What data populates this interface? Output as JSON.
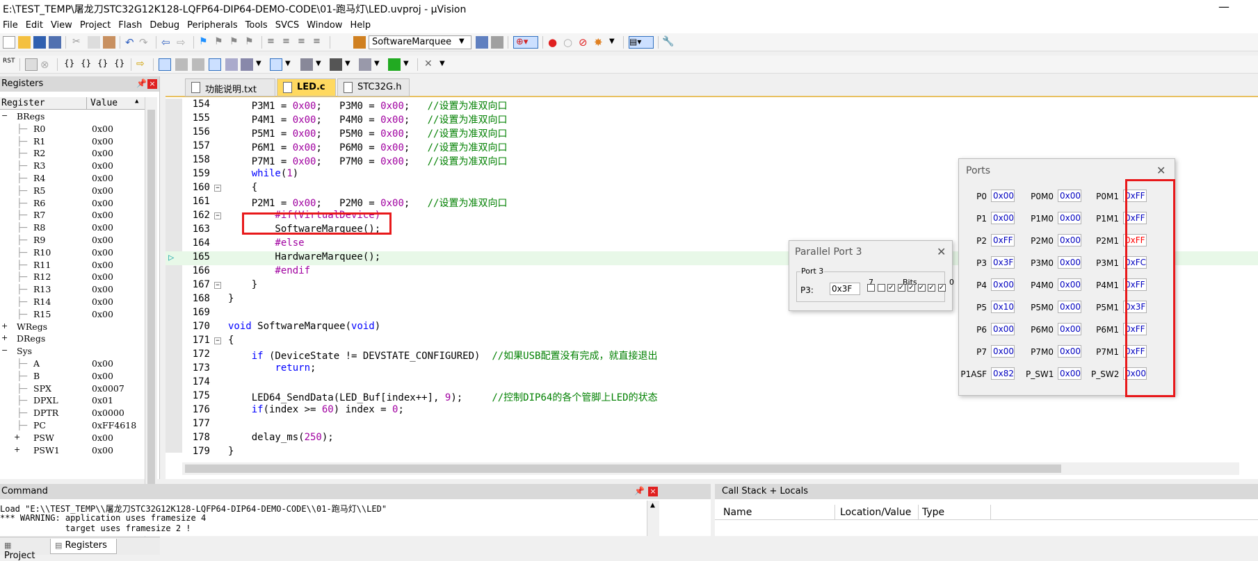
{
  "window": {
    "title": "E:\\TEST_TEMP\\屠龙刀STC32G12K128-LQFP64-DIP64-DEMO-CODE\\01-跑马灯\\LED.uvproj - µVision",
    "minimize": "—"
  },
  "menu": [
    "File",
    "Edit",
    "View",
    "Project",
    "Flash",
    "Debug",
    "Peripherals",
    "Tools",
    "SVCS",
    "Window",
    "Help"
  ],
  "toolbar": {
    "target_combo": "SoftwareMarquee"
  },
  "registers_panel": {
    "title": "Registers",
    "col_register": "Register",
    "col_value": "Value",
    "rows": [
      {
        "name": "BRegs",
        "value": "",
        "level": 0,
        "toggle": "−"
      },
      {
        "name": "R0",
        "value": "0x00",
        "level": 1
      },
      {
        "name": "R1",
        "value": "0x00",
        "level": 1
      },
      {
        "name": "R2",
        "value": "0x00",
        "level": 1
      },
      {
        "name": "R3",
        "value": "0x00",
        "level": 1
      },
      {
        "name": "R4",
        "value": "0x00",
        "level": 1
      },
      {
        "name": "R5",
        "value": "0x00",
        "level": 1
      },
      {
        "name": "R6",
        "value": "0x00",
        "level": 1
      },
      {
        "name": "R7",
        "value": "0x00",
        "level": 1
      },
      {
        "name": "R8",
        "value": "0x00",
        "level": 1
      },
      {
        "name": "R9",
        "value": "0x00",
        "level": 1
      },
      {
        "name": "R10",
        "value": "0x00",
        "level": 1
      },
      {
        "name": "R11",
        "value": "0x00",
        "level": 1
      },
      {
        "name": "R12",
        "value": "0x00",
        "level": 1
      },
      {
        "name": "R13",
        "value": "0x00",
        "level": 1
      },
      {
        "name": "R14",
        "value": "0x00",
        "level": 1
      },
      {
        "name": "R15",
        "value": "0x00",
        "level": 1
      },
      {
        "name": "WRegs",
        "value": "",
        "level": 0,
        "toggle": "+"
      },
      {
        "name": "DRegs",
        "value": "",
        "level": 0,
        "toggle": "+"
      },
      {
        "name": "Sys",
        "value": "",
        "level": 0,
        "toggle": "−"
      },
      {
        "name": "A",
        "value": "0x00",
        "level": 1
      },
      {
        "name": "B",
        "value": "0x00",
        "level": 1
      },
      {
        "name": "SPX",
        "value": "0x0007",
        "level": 1
      },
      {
        "name": "DPXL",
        "value": "0x01",
        "level": 1
      },
      {
        "name": "DPTR",
        "value": "0x0000",
        "level": 1
      },
      {
        "name": "PC",
        "value": "0xFF4618",
        "level": 1
      },
      {
        "name": "PSW",
        "value": "0x00",
        "level": 1,
        "toggle": "+"
      },
      {
        "name": "PSW1",
        "value": "0x00",
        "level": 1,
        "toggle": "+"
      }
    ],
    "tabs": [
      "Project",
      "Registers"
    ]
  },
  "editor": {
    "tabs": [
      "功能说明.txt",
      "LED.c",
      "STC32G.h"
    ],
    "active_tab": "LED.c",
    "lines": [
      {
        "n": "154",
        "code": "    P3M1 = 0x00;   P3M0 = 0x00;   //设置为准双向口"
      },
      {
        "n": "155",
        "code": "    P4M1 = 0x00;   P4M0 = 0x00;   //设置为准双向口"
      },
      {
        "n": "156",
        "code": "    P5M1 = 0x00;   P5M0 = 0x00;   //设置为准双向口"
      },
      {
        "n": "157",
        "code": "    P6M1 = 0x00;   P6M0 = 0x00;   //设置为准双向口"
      },
      {
        "n": "158",
        "code": "    P7M1 = 0x00;   P7M0 = 0x00;   //设置为准双向口"
      },
      {
        "n": "159",
        "code": "    while(1)"
      },
      {
        "n": "160",
        "code": "    {",
        "fold": "−"
      },
      {
        "n": "161",
        "code": "    P2M1 = 0x00;   P2M0 = 0x00;   //设置为准双向口"
      },
      {
        "n": "162",
        "code": "        #if(VirtualDevice)",
        "fold": "−"
      },
      {
        "n": "163",
        "code": "        SoftwareMarquee();"
      },
      {
        "n": "164",
        "code": "        #else"
      },
      {
        "n": "165",
        "code": "        HardwareMarquee();",
        "current": true
      },
      {
        "n": "166",
        "code": "        #endif"
      },
      {
        "n": "167",
        "code": "    }",
        "fold": "−"
      },
      {
        "n": "168",
        "code": "}"
      },
      {
        "n": "169",
        "code": ""
      },
      {
        "n": "170",
        "code": "void SoftwareMarquee(void)"
      },
      {
        "n": "171",
        "code": "{",
        "fold": "−"
      },
      {
        "n": "172",
        "code": "    if (DeviceState != DEVSTATE_CONFIGURED)  //如果USB配置没有完成，就直接退出"
      },
      {
        "n": "173",
        "code": "        return;"
      },
      {
        "n": "174",
        "code": ""
      },
      {
        "n": "175",
        "code": "    LED64_SendData(LED_Buf[index++], 9);     //控制DIP64的各个管脚上LED的状态"
      },
      {
        "n": "176",
        "code": "    if(index >= 60) index = 0;"
      },
      {
        "n": "177",
        "code": ""
      },
      {
        "n": "178",
        "code": "    delay_ms(250);"
      },
      {
        "n": "179",
        "code": "}"
      }
    ]
  },
  "parallel_port_dialog": {
    "title": "Parallel Port 3",
    "group": "Port 3",
    "label": "P3:",
    "value": "0x3F",
    "bits_label": "Bits",
    "bit_high": "7",
    "bit_low": "0",
    "bits": [
      false,
      false,
      true,
      true,
      true,
      true,
      true,
      true
    ]
  },
  "ports_dialog": {
    "title": "Ports",
    "rows": [
      {
        "a": "P0",
        "av": "0x00",
        "b": "P0M0",
        "bv": "0x00",
        "c": "P0M1",
        "cv": "0xFF"
      },
      {
        "a": "P1",
        "av": "0x00",
        "b": "P1M0",
        "bv": "0x00",
        "c": "P1M1",
        "cv": "0xFF"
      },
      {
        "a": "P2",
        "av": "0xFF",
        "b": "P2M0",
        "bv": "0x00",
        "c": "P2M1",
        "cv": "0xFF",
        "c_red": true
      },
      {
        "a": "P3",
        "av": "0x3F",
        "b": "P3M0",
        "bv": "0x00",
        "c": "P3M1",
        "cv": "0xFC"
      },
      {
        "a": "P4",
        "av": "0x00",
        "b": "P4M0",
        "bv": "0x00",
        "c": "P4M1",
        "cv": "0xFF"
      },
      {
        "a": "P5",
        "av": "0x10",
        "b": "P5M0",
        "bv": "0x00",
        "c": "P5M1",
        "cv": "0x3F"
      },
      {
        "a": "P6",
        "av": "0x00",
        "b": "P6M0",
        "bv": "0x00",
        "c": "P6M1",
        "cv": "0xFF"
      },
      {
        "a": "P7",
        "av": "0x00",
        "b": "P7M0",
        "bv": "0x00",
        "c": "P7M1",
        "cv": "0xFF"
      },
      {
        "a": "P1ASF",
        "av": "0x82",
        "b": "P_SW1",
        "bv": "0x00",
        "c": "P_SW2",
        "cv": "0x00"
      }
    ]
  },
  "command_panel": {
    "title": "Command",
    "lines": [
      "Load \"E:\\\\TEST_TEMP\\\\屠龙刀STC32G12K128-LQFP64-DIP64-DEMO-CODE\\\\01-跑马灯\\\\LED\"",
      "*** WARNING: application uses framesize 4",
      "             target uses framesize 2 !"
    ]
  },
  "call_stack_panel": {
    "title": "Call Stack + Locals",
    "columns": [
      "Name",
      "Location/Value",
      "Type"
    ]
  },
  "colors": {
    "highlight_box": "#e8181a",
    "active_tab": "#ffd960",
    "current_line": "#e8f8e8"
  }
}
